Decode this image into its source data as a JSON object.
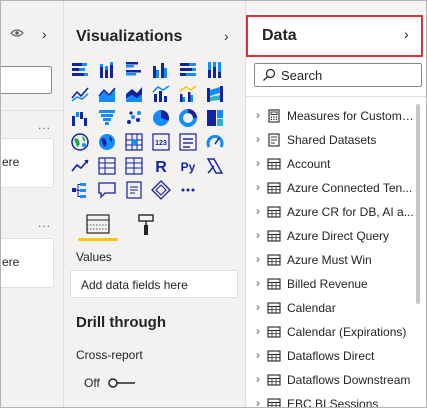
{
  "filters_pane": {
    "collapse_chevron": "›",
    "card1_text": "ere",
    "card2_text": "ere",
    "more_options": "..."
  },
  "visualizations": {
    "title": "Visualizations",
    "chevron": "›",
    "icons": [
      "stacked-bar-chart-icon",
      "stacked-column-chart-icon",
      "clustered-bar-chart-icon",
      "clustered-column-chart-icon",
      "100-stacked-bar-chart-icon",
      "100-stacked-column-chart-icon",
      "line-chart-icon",
      "area-chart-icon",
      "stacked-area-chart-icon",
      "line-and-column-chart-icon",
      "line-and-clustered-column-chart-icon",
      "ribbon-chart-icon",
      "waterfall-chart-icon",
      "funnel-chart-icon",
      "scatter-chart-icon",
      "pie-chart-icon",
      "donut-chart-icon",
      "treemap-icon",
      "map-icon",
      "filled-map-icon",
      "shape-map-icon",
      "gauge-icon",
      "card-icon",
      "multi-row-card-icon",
      "kpi-icon",
      "slicer-icon",
      "table-icon",
      "matrix-icon",
      "r-visual-icon",
      "python-visual-icon",
      "decomposition-tree-icon",
      "qa-icon",
      "smart-narrative-icon",
      "paginated-report-icon",
      "power-apps-icon",
      "more-visuals-icon"
    ],
    "values_label": "Values",
    "values_placeholder": "Add data fields here",
    "drill_title": "Drill through",
    "cross_report_label": "Cross-report",
    "toggle_state": "Off",
    "accent_color": "#f2c811"
  },
  "data": {
    "title": "Data",
    "chevron": "›",
    "search_placeholder": "Search",
    "highlight_color": "#e0303b",
    "fields": [
      {
        "label": "Measures for Custom ...",
        "icon": "calculator-icon"
      },
      {
        "label": "Shared Datasets",
        "icon": "folder-icon"
      },
      {
        "label": "Account",
        "icon": "table-icon"
      },
      {
        "label": "Azure Connected Ten...",
        "icon": "table-icon"
      },
      {
        "label": "Azure CR for DB, AI a...",
        "icon": "table-icon"
      },
      {
        "label": "Azure Direct Query",
        "icon": "table-icon"
      },
      {
        "label": "Azure Must Win",
        "icon": "table-icon"
      },
      {
        "label": "Billed Revenue",
        "icon": "table-icon"
      },
      {
        "label": "Calendar",
        "icon": "table-icon"
      },
      {
        "label": "Calendar (Expirations)",
        "icon": "table-icon"
      },
      {
        "label": "Dataflows Direct",
        "icon": "table-icon"
      },
      {
        "label": "Dataflows Downstream",
        "icon": "table-icon"
      },
      {
        "label": "EBC BI Sessions",
        "icon": "table-icon"
      }
    ]
  }
}
